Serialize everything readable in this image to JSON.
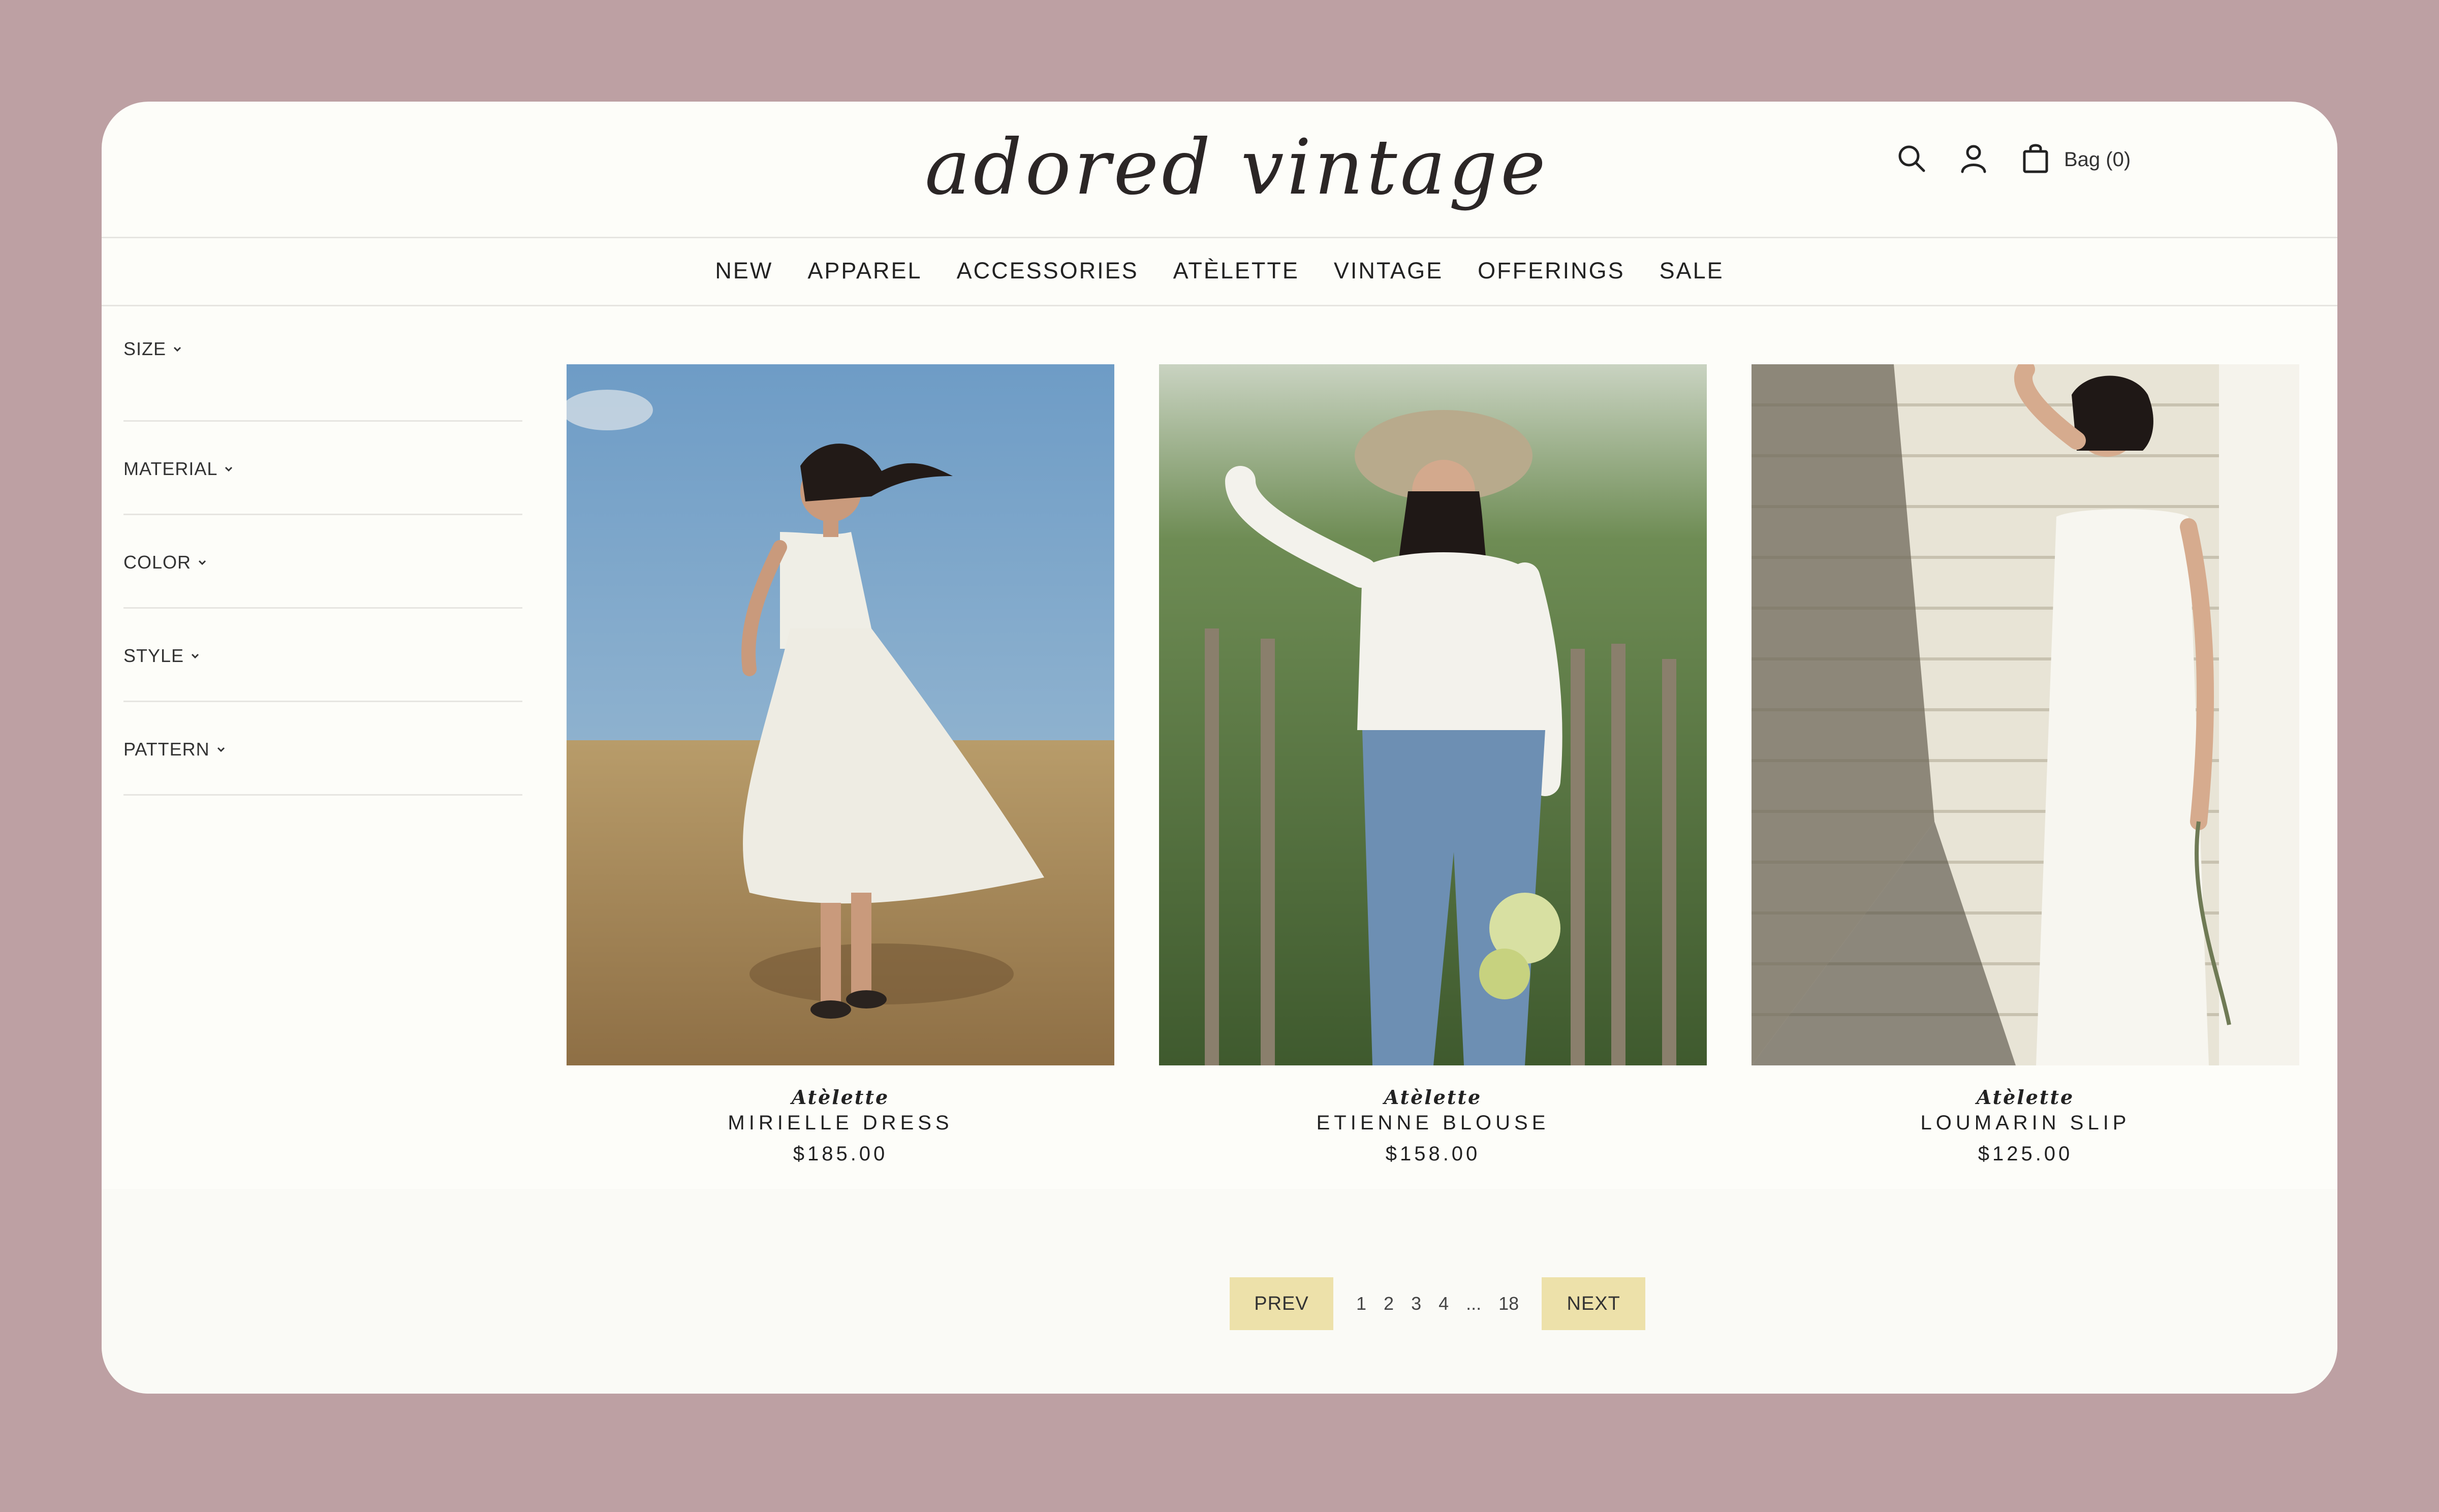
{
  "header": {
    "logo_text": "adored vintage",
    "icons": {
      "search": "search-icon",
      "account": "user-icon",
      "bag": "shopping-bag-icon"
    },
    "bag_label": "Bag (0)"
  },
  "nav": {
    "items": [
      "NEW",
      "APPAREL",
      "ACCESSORIES",
      "ATÈLETTE",
      "VINTAGE",
      "OFFERINGS",
      "SALE"
    ]
  },
  "filters": {
    "items": [
      "SIZE",
      "MATERIAL",
      "COLOR",
      "STYLE",
      "PATTERN"
    ]
  },
  "products": [
    {
      "brand": "Atèlette",
      "name": "MIRIELLE DRESS",
      "price": "$185.00"
    },
    {
      "brand": "Atèlette",
      "name": "ETIENNE BLOUSE",
      "price": "$158.00"
    },
    {
      "brand": "Atèlette",
      "name": "LOUMARIN SLIP",
      "price": "$125.00"
    }
  ],
  "pagination": {
    "prev_label": "PREV",
    "pages": [
      "1",
      "2",
      "3",
      "4"
    ],
    "ellipsis": "...",
    "last_page": "18",
    "next_label": "NEXT"
  },
  "colors": {
    "background": "#bda0a3",
    "card": "#fdfdf9",
    "pager_button": "#ede1aa"
  }
}
